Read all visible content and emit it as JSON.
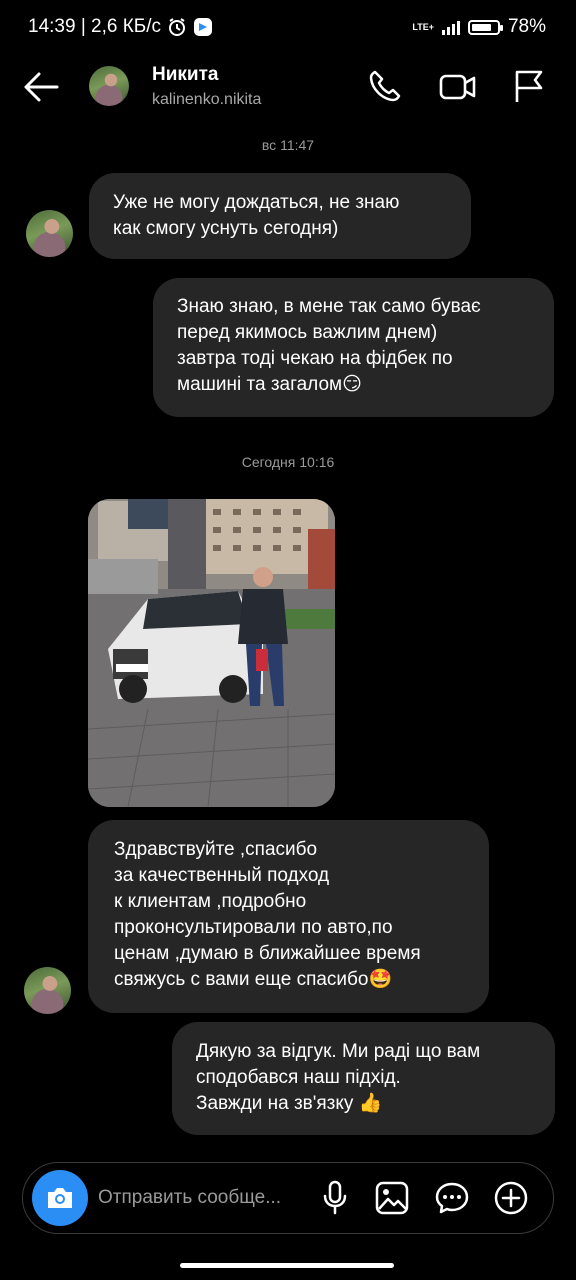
{
  "status_bar": {
    "time_speed": "14:39 | 2,6 КБ/с",
    "network": "LTE+",
    "battery": "78%",
    "battery_level": 0.78
  },
  "header": {
    "name": "Никита",
    "username": "kalinenko.nikita",
    "icons": [
      "back-arrow-icon",
      "phone-icon",
      "video-icon",
      "flag-icon"
    ]
  },
  "messages": {
    "timestamp_1": "вс 11:47",
    "msg_1": "Уже не могу дождаться, не знаю\nкак смогу уснуть сегодня)",
    "msg_2": "Знаю знаю, в мене так само буває\nперед якимось важлим днем)\nзавтра тоді чекаю на фідбек по\nмашині та загалом😏",
    "timestamp_2": "Сегодня 10:16",
    "msg_4": "Здравствуйте ,спасибо\nза качественный подход\nк клиентам ,подробно\nпроконсультировали по авто,по\nценам ,думаю в ближайшее время\nсвяжусь с вами еще спасибо🤩",
    "msg_5": "Дякую за відгук. Ми раді що вам\nсподобався наш підхід.\nЗавжди на зв'язку 👍"
  },
  "composer": {
    "placeholder": "Отправить сообще...",
    "icons": [
      "camera-icon",
      "microphone-icon",
      "gallery-icon",
      "sticker-icon",
      "add-icon"
    ]
  },
  "colors": {
    "background": "#000000",
    "bubble": "#262626",
    "accent": "#2a8ef5"
  }
}
